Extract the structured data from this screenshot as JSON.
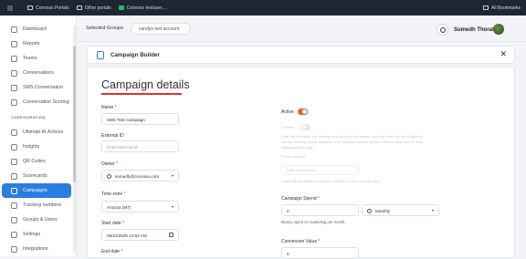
{
  "bookmarks": {
    "items": [
      {
        "label": "Convoso Portals",
        "icon": "folder-icon"
      },
      {
        "label": "Other portals",
        "icon": "folder-icon"
      },
      {
        "label": "Convoso testuser....",
        "icon": "convoso-icon"
      }
    ],
    "all_label": "All Bookmarks"
  },
  "sidebar": {
    "items": [
      {
        "label": "Dashboard",
        "icon": "dashboard-icon"
      },
      {
        "label": "Reports",
        "icon": "reports-icon"
      },
      {
        "label": "Teams",
        "icon": "teams-icon"
      },
      {
        "label": "Conversations",
        "icon": "conversations-icon"
      },
      {
        "label": "SMS Conversation",
        "icon": "sms-icon"
      },
      {
        "label": "Conversation Scoring",
        "icon": "scoring-icon"
      }
    ],
    "section_label": "CONFIGURATION",
    "config_items": [
      {
        "label": "Ultimate AI Actions",
        "icon": "ai-icon"
      },
      {
        "label": "Insights",
        "icon": "insights-icon"
      },
      {
        "label": "QR Codes",
        "icon": "qr-icon"
      },
      {
        "label": "Scorecards",
        "icon": "scorecards-icon"
      },
      {
        "label": "Campaigns",
        "icon": "campaigns-icon"
      },
      {
        "label": "Tracking numbers",
        "icon": "tracking-icon"
      },
      {
        "label": "Groups & Users",
        "icon": "groups-icon"
      },
      {
        "label": "Settings",
        "icon": "settings-icon"
      },
      {
        "label": "Integrations",
        "icon": "integrations-icon"
      }
    ],
    "active": "Campaigns"
  },
  "topbar": {
    "selected_groups_label": "Selected Groups",
    "selected_group": "candys test account",
    "user_name": "Sumedh Thorat"
  },
  "builder": {
    "title": "Campaign Builder",
    "close": "✕"
  },
  "details": {
    "title": "Campaign details",
    "name_label": "Name",
    "name_value": "SMS Test Campaign",
    "external_id_label": "External ID",
    "external_id_placeholder": "Enter external id",
    "owner_label": "Owner",
    "owner_value": "sumedh@convoso.com",
    "timezone_label": "Time zone",
    "timezone_value": "Arizona (MT)",
    "start_label": "Start date",
    "start_value": "08/22/2025 12:53 AM",
    "end_label": "End date",
    "required_mark": "*"
  },
  "right": {
    "active_label": "Active",
    "active_on": true,
    "referral_label": "Referral",
    "referral_on": false,
    "referral_help": "After the end date, the referral recording will be paused, and the caller will be notified to call the existing phone numbers. The tracking number will be retained when the 30 days referral period ends.",
    "phone_label": "Phone number",
    "phone_placeholder": "Enter next number",
    "phone_help": "Users will be notified to call this number, for the next 30 days.",
    "spend_label": "Campaign Spend",
    "spend_value": "0",
    "spend_period": "Monthly",
    "spend_help": "Money spent on marketing per month.",
    "conversion_label": "Conversion Value",
    "conversion_value": "0"
  },
  "colors": {
    "accent": "#2a7de1",
    "toggle_on": "#e8622a",
    "underline": "#d9342b"
  }
}
